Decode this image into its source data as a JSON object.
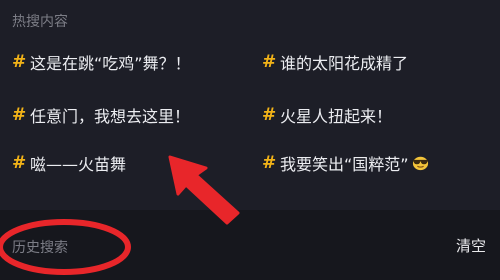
{
  "hot": {
    "title": "热搜内容",
    "items": [
      {
        "hash": "#",
        "text": "这是在跳“吃鸡”舞？！"
      },
      {
        "hash": "#",
        "text": "谁的太阳花成精了"
      },
      {
        "hash": "#",
        "text": "任意门，我想去这里！"
      },
      {
        "hash": "#",
        "text": "火星人扭起来！"
      },
      {
        "hash": "#",
        "text": "嗞——火苗舞"
      },
      {
        "hash": "#",
        "text": "我要笑出“国粹范”",
        "icon": "sunglasses-face-emoji"
      }
    ]
  },
  "history": {
    "title": "历史搜索",
    "clear_label": "清空"
  },
  "annotation": {
    "arrow_color": "#e8262a",
    "circle_color": "#e8262a"
  }
}
